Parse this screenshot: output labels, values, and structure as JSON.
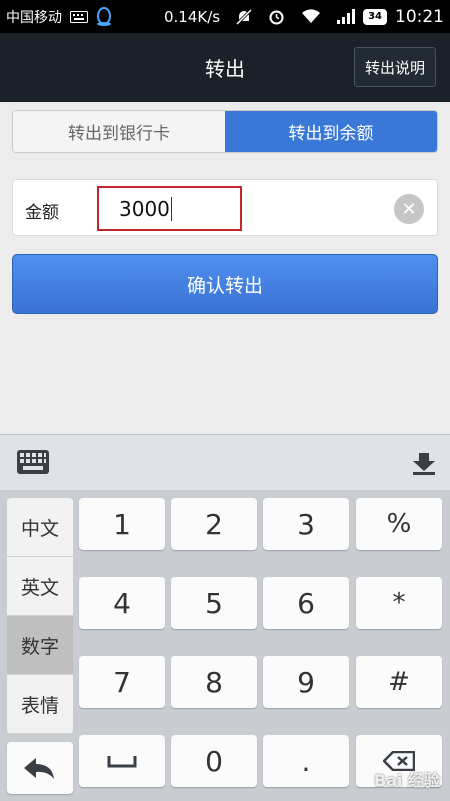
{
  "status_bar": {
    "carrier": "中国移动",
    "speed": "0.14K/s",
    "battery": "34",
    "time": "10:21"
  },
  "header": {
    "title": "转出",
    "help_label": "转出说明"
  },
  "tabs": [
    {
      "label": "转出到银行卡",
      "active": false
    },
    {
      "label": "转出到余额",
      "active": true
    }
  ],
  "amount": {
    "label": "金额",
    "value": "3000"
  },
  "confirm_label": "确认转出",
  "keyboard": {
    "modes": [
      "中文",
      "英文",
      "数字",
      "表情"
    ],
    "selected_mode": "数字",
    "keys": [
      "1",
      "2",
      "3",
      "%",
      "4",
      "5",
      "6",
      "*",
      "7",
      "8",
      "9",
      "#",
      "0",
      "."
    ]
  },
  "watermark": "Bai 经验"
}
